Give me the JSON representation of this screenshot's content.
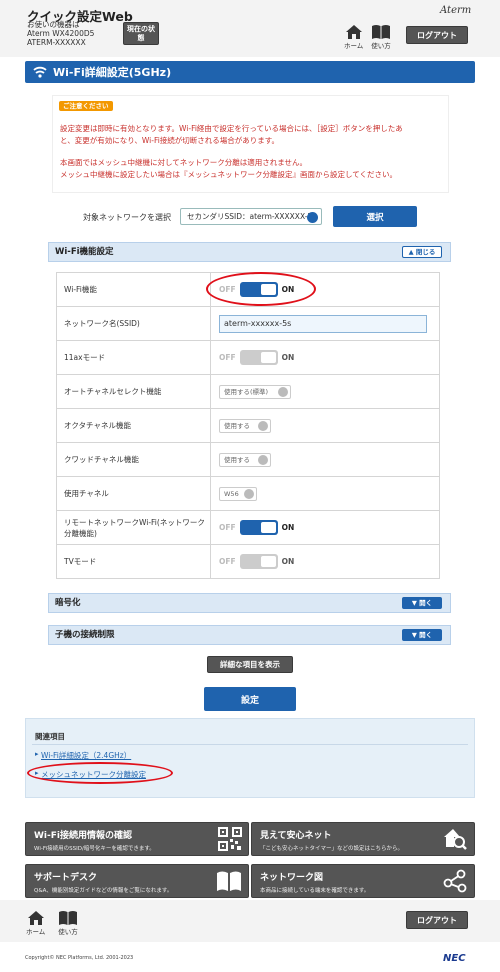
{
  "header": {
    "title": "クイック設定Web",
    "device_label": "お使いの機器は",
    "model": "Aterm WX4200D5",
    "device_id": "ATERM-XXXXXX",
    "status_button": "現在の状態",
    "brand": "Aterm",
    "home_label": "ホーム",
    "help_label": "使い方",
    "logout_label": "ログアウト"
  },
  "page_title": "Wi-Fi詳細設定(5GHz)",
  "notice": {
    "badge": "ご注意ください",
    "line1": "設定変更は即時に有効となります。Wi-Fi経由で設定を行っている場合には、［設定］ボタンを押したあ",
    "line2": "と、変更が有効になり、Wi-Fi接続が切断される場合があります。",
    "line3": "本画面ではメッシュ中継機に対してネットワーク分離は適用されません。",
    "line4": "メッシュ中継機に設定したい場合は『メッシュネットワーク分離設定』画面から設定してください。"
  },
  "network_select": {
    "label": "対象ネットワークを選択",
    "value": "セカンダリSSID：aterm-XXXXXX-5s",
    "button": "選択"
  },
  "wifi_section": {
    "title": "Wi-Fi機能設定",
    "toggle": "閉じる",
    "rows": [
      {
        "label": "Wi-Fi機能",
        "off": "OFF",
        "on": "ON"
      },
      {
        "label": "ネットワーク名(SSID)",
        "value": "aterm-xxxxxx-5s"
      },
      {
        "label": "11axモード",
        "off": "OFF",
        "on": "ON"
      },
      {
        "label": "オートチャネルセレクト機能",
        "value": "使用する(標準)"
      },
      {
        "label": "オクタチャネル機能",
        "value": "使用する"
      },
      {
        "label": "クワッドチャネル機能",
        "value": "使用する"
      },
      {
        "label": "使用チャネル",
        "value": "W56"
      },
      {
        "label": "リモートネットワークWi-Fi(ネットワーク分離機能)",
        "off": "OFF",
        "on": "ON"
      },
      {
        "label": "TVモード",
        "off": "OFF",
        "on": "ON"
      }
    ]
  },
  "encryption_section": {
    "title": "暗号化",
    "toggle": "開く"
  },
  "client_section": {
    "title": "子機の接続制限",
    "toggle": "開く"
  },
  "detail_button": "詳細な項目を表示",
  "set_button": "設定",
  "related": {
    "title": "関連項目",
    "links": [
      "Wi-Fi詳細設定（2.4GHz）",
      "メッシュネットワーク分離設定"
    ]
  },
  "tiles": [
    {
      "title": "Wi-Fi接続用情報の確認",
      "desc": "Wi-Fi接続用のSSID/暗号化キーを確認できます。",
      "icon": "qr-code-icon"
    },
    {
      "title": "見えて安心ネット",
      "desc": "「こども安心ネットタイマー」などの設定はこちらから。",
      "icon": "house-search-icon"
    },
    {
      "title": "サポートデスク",
      "desc": "Q&A、機能別設定ガイドなどの情報をご覧になれます。",
      "icon": "book-icon"
    },
    {
      "title": "ネットワーク図",
      "desc": "本商品に接続している端末を確認できます。",
      "icon": "network-icon"
    }
  ],
  "footer": {
    "home_label": "ホーム",
    "help_label": "使い方",
    "logout_label": "ログアウト",
    "copyright": "Copyright© NEC Platforms, Ltd. 2001-2023",
    "logo": "NEC"
  }
}
